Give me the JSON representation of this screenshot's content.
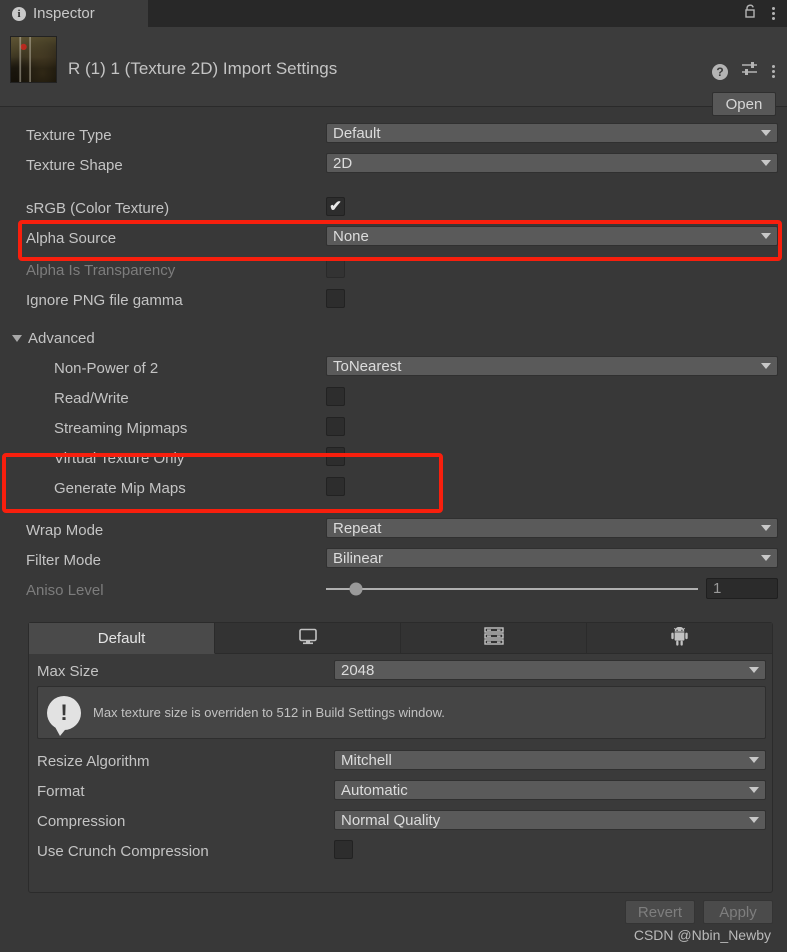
{
  "window": {
    "tab_label": "Inspector",
    "tab_icon": "info-icon",
    "lock_icon": "lock-open-icon",
    "menu_icon": "kebab-menu-icon"
  },
  "header": {
    "asset_title": "R (1) 1 (Texture 2D) Import Settings",
    "thumbnail_alt": "texture-thumbnail",
    "help_icon": "help-icon",
    "preset_icon": "preset-settings-icon",
    "menu_icon": "kebab-menu-icon",
    "open_button": "Open"
  },
  "settings": {
    "texture_type": {
      "label": "Texture Type",
      "value": "Default"
    },
    "texture_shape": {
      "label": "Texture Shape",
      "value": "2D"
    },
    "srgb": {
      "label": "sRGB (Color Texture)",
      "checked": true,
      "check_glyph": "✔"
    },
    "alpha_source": {
      "label": "Alpha Source",
      "value": "None"
    },
    "alpha_is_transparency": {
      "label": "Alpha Is Transparency",
      "checked": false,
      "disabled": true
    },
    "ignore_png_gamma": {
      "label": "Ignore PNG file gamma",
      "checked": false
    }
  },
  "advanced": {
    "title": "Advanced",
    "expanded": true,
    "non_power_of_2": {
      "label": "Non-Power of 2",
      "value": "ToNearest"
    },
    "read_write": {
      "label": "Read/Write",
      "checked": false
    },
    "streaming_mipmaps": {
      "label": "Streaming Mipmaps",
      "checked": false
    },
    "virtual_texture_only": {
      "label": "Virtual Texture Only",
      "checked": false
    },
    "generate_mip_maps": {
      "label": "Generate Mip Maps",
      "checked": false
    }
  },
  "sampling": {
    "wrap_mode": {
      "label": "Wrap Mode",
      "value": "Repeat"
    },
    "filter_mode": {
      "label": "Filter Mode",
      "value": "Bilinear"
    },
    "aniso_level": {
      "label": "Aniso Level",
      "value": "1",
      "disabled": true,
      "slider_percent": 8
    }
  },
  "platform": {
    "tabs": [
      {
        "label": "Default",
        "icon": "text-label",
        "active": true
      },
      {
        "label": "",
        "icon": "monitor-icon",
        "active": false
      },
      {
        "label": "",
        "icon": "webgl-server-icon",
        "active": false
      },
      {
        "label": "",
        "icon": "android-robot-icon",
        "active": false
      }
    ],
    "max_size": {
      "label": "Max Size",
      "value": "2048"
    },
    "info": {
      "icon": "exclamation-bubble-icon",
      "message": "Max texture size is overriden to 512 in Build Settings window."
    },
    "resize_algorithm": {
      "label": "Resize Algorithm",
      "value": "Mitchell"
    },
    "format": {
      "label": "Format",
      "value": "Automatic"
    },
    "compression": {
      "label": "Compression",
      "value": "Normal Quality"
    },
    "use_crunch_compression": {
      "label": "Use Crunch Compression",
      "checked": false
    }
  },
  "footer": {
    "revert": "Revert",
    "apply": "Apply",
    "watermark": "CSDN @Nbin_Newby"
  },
  "highlights": {
    "accent_color": "#f81f0d",
    "box1_target": "alpha-source-row",
    "box2_target": "generate-mip-maps-row"
  },
  "colors": {
    "panel_bg": "#383838",
    "header_bg": "#3c3c3c",
    "tabstrip_bg": "#282828",
    "popup_bg": "#5a5a5a",
    "label": "#c4c4c4",
    "label_disabled": "#7c7c7c"
  }
}
